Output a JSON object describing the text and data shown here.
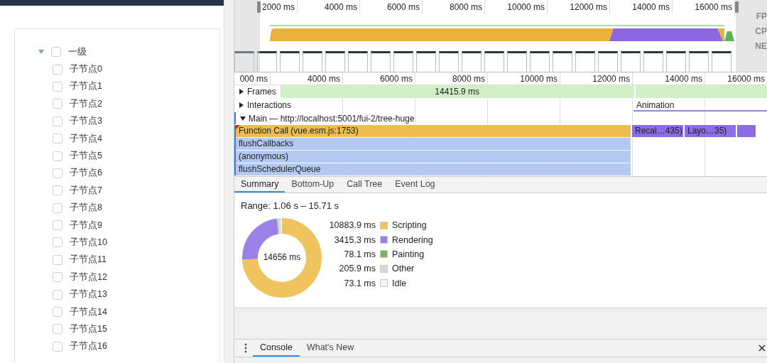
{
  "page": {
    "tree": {
      "label": "一级",
      "expanded": true,
      "checked": false,
      "children": [
        {
          "label": "子节点0",
          "checked": false
        },
        {
          "label": "子节点1",
          "checked": false
        },
        {
          "label": "子节点2",
          "checked": false
        },
        {
          "label": "子节点3",
          "checked": false
        },
        {
          "label": "子节点4",
          "checked": false
        },
        {
          "label": "子节点5",
          "checked": false
        },
        {
          "label": "子节点6",
          "checked": false
        },
        {
          "label": "子节点7",
          "checked": false
        },
        {
          "label": "子节点8",
          "checked": false
        },
        {
          "label": "子节点9",
          "checked": false
        },
        {
          "label": "子节点10",
          "checked": false
        },
        {
          "label": "子节点11",
          "checked": false
        },
        {
          "label": "子节点12",
          "checked": false
        },
        {
          "label": "子节点13",
          "checked": false
        },
        {
          "label": "子节点14",
          "checked": false
        },
        {
          "label": "子节点15",
          "checked": false
        },
        {
          "label": "子节点16",
          "checked": false
        }
      ]
    }
  },
  "devtools": {
    "overview": {
      "ticks": [
        "2000 ms",
        "4000 ms",
        "6000 ms",
        "8000 ms",
        "10000 ms",
        "12000 ms",
        "14000 ms",
        "16000 ms"
      ],
      "track_labels": [
        "FP",
        "CP",
        "NE"
      ]
    },
    "timeline": {
      "ticks": [
        "000 ms",
        "4000 ms",
        "6000 ms",
        "8000 ms",
        "10000 ms",
        "12000 ms",
        "14000 ms",
        "16000 ms"
      ],
      "frames": {
        "label": "Frames",
        "expanded": false,
        "duration": "14415.9 ms"
      },
      "interactions": {
        "label": "Interactions",
        "expanded": false,
        "event": "Animation"
      },
      "main": {
        "label": "Main — http://localhost:5001/fui-2/tree-huge",
        "expanded": true
      },
      "flame_rows": [
        [
          {
            "kind": "scripting",
            "label": "Function Call (vue.esm.js:1753)"
          },
          {
            "kind": "rendering",
            "label": "Recal…435)"
          },
          {
            "kind": "rendering",
            "label": "Layo…35)"
          },
          {
            "kind": "rendering-small"
          }
        ],
        [
          {
            "kind": "js",
            "label": "flushCallbacks"
          }
        ],
        [
          {
            "kind": "js",
            "label": "(anonymous)"
          }
        ],
        [
          {
            "kind": "js",
            "label": "flushSchedulerQueue"
          }
        ]
      ]
    },
    "tabs": [
      {
        "label": "Summary",
        "selected": true
      },
      {
        "label": "Bottom-Up",
        "selected": false
      },
      {
        "label": "Call Tree",
        "selected": false
      },
      {
        "label": "Event Log",
        "selected": false
      }
    ],
    "summary": {
      "range": "Range: 1.06 s – 15.71 s",
      "total": "14656 ms",
      "legend": [
        {
          "value": "10883.9 ms",
          "color": "#efc45e"
        },
        {
          "value": "3415.3 ms",
          "color": "#9b80e8"
        },
        {
          "value": "78.1 ms",
          "color": "#76b366"
        },
        {
          "value": "205.9 ms",
          "color": "#d8d8d8"
        },
        {
          "value": "73.1 ms",
          "color": "#f4f4f4"
        }
      ],
      "chart_data": {
        "type": "donut",
        "categories": [
          "Scripting",
          "Rendering",
          "Painting",
          "Other",
          "Idle"
        ],
        "values": [
          74.26,
          23.3,
          0.53,
          1.41,
          0.5
        ]
      }
    },
    "drawer_tabs": [
      {
        "label": "Console",
        "selected": true
      },
      {
        "label": "What's New",
        "selected": false
      }
    ]
  }
}
